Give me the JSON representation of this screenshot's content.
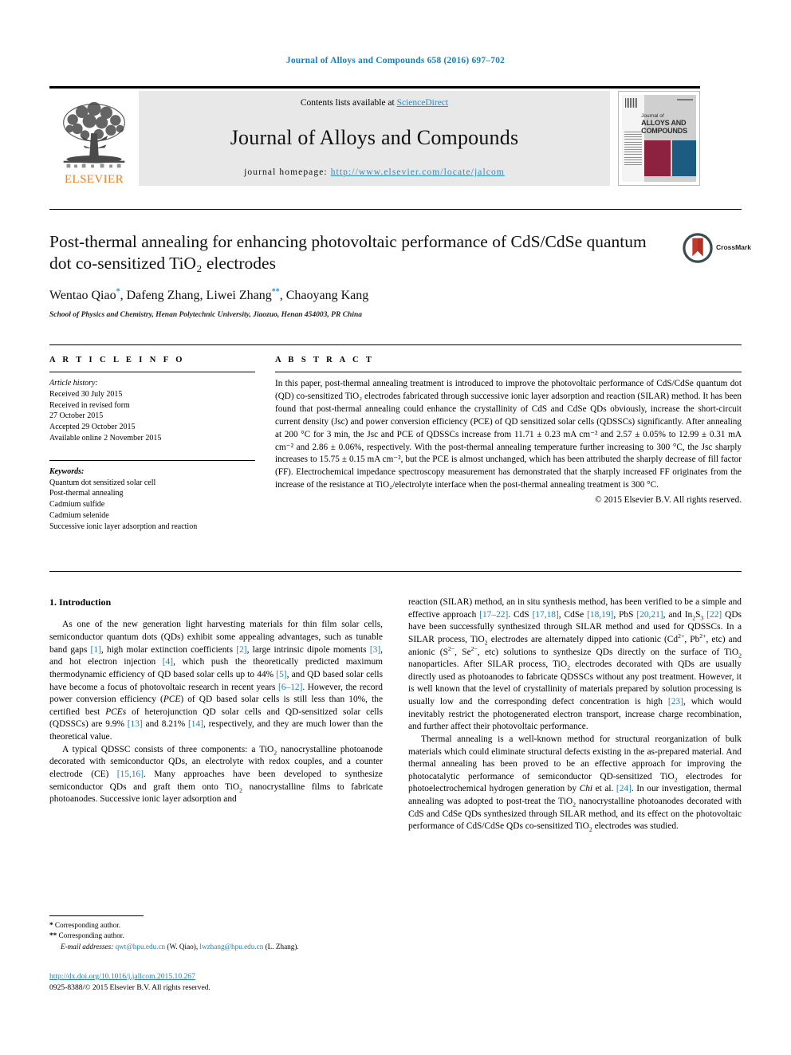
{
  "journal_ref": "Journal of Alloys and Compounds 658 (2016) 697–702",
  "masthead": {
    "contents_prefix": "Contents lists available at ",
    "sciencedirect": "ScienceDirect",
    "journal_title": "Journal of Alloys and Compounds",
    "homepage_prefix": "journal homepage: ",
    "homepage_url": "http://www.elsevier.com/locate/jalcom",
    "publisher": "ELSEVIER",
    "cover_title_small": "Journal of",
    "cover_title_main": "ALLOYS AND COMPOUNDS"
  },
  "article": {
    "title": "Post-thermal annealing for enhancing photovoltaic performance of CdS/CdSe quantum dot co-sensitized TiO₂ electrodes",
    "authors": "Wentao Qiao*, Dafeng Zhang, Liwei Zhang**, Chaoyang Kang",
    "affiliation": "School of Physics and Chemistry, Henan Polytechnic University, Jiaozuo, Henan 454003, PR China",
    "crossmark_label": "CrossMark"
  },
  "article_info": {
    "heading": "A R T I C L E  I N F O",
    "history_label": "Article history:",
    "history": [
      "Received 30 July 2015",
      "Received in revised form",
      "27 October 2015",
      "Accepted 29 October 2015",
      "Available online 2 November 2015"
    ],
    "keywords_label": "Keywords:",
    "keywords": [
      "Quantum dot sensitized solar cell",
      "Post-thermal annealing",
      "Cadmium sulfide",
      "Cadmium selenide",
      "Successive ionic layer adsorption and reaction"
    ]
  },
  "abstract": {
    "heading": "A B S T R A C T",
    "text": "In this paper, post-thermal annealing treatment is introduced to improve the photovoltaic performance of CdS/CdSe quantum dot (QD) co-sensitized TiO₂ electrodes fabricated through successive ionic layer adsorption and reaction (SILAR) method. It has been found that post-thermal annealing could enhance the crystallinity of CdS and CdSe QDs obviously, increase the short-circuit current density (Jsc) and power conversion efficiency (PCE) of QD sensitized solar cells (QDSSCs) significantly. After annealing at 200 °C for 3 min, the Jsc and PCE of QDSSCs increase from 11.71 ± 0.23 mA cm⁻² and 2.57 ± 0.05% to 12.99 ± 0.31 mA cm⁻² and 2.86 ± 0.06%, respectively. With the post-thermal annealing temperature further increasing to 300 °C, the Jsc sharply increases to 15.75 ± 0.15 mA cm⁻², but the PCE is almost unchanged, which has been attributed the sharply decrease of fill factor (FF). Electrochemical impedance spectroscopy measurement has demonstrated that the sharply increased FF originates from the increase of the resistance at TiO₂/electrolyte interface when the post-thermal annealing treatment is 300 °C.",
    "copyright": "© 2015 Elsevier B.V. All rights reserved."
  },
  "introduction": {
    "heading": "1. Introduction",
    "left_paragraphs": [
      "As one of the new generation light harvesting materials for thin film solar cells, semiconductor quantum dots (QDs) exhibit some appealing advantages, such as tunable band gaps [1], high molar extinction coefficients [2], large intrinsic dipole moments [3], and hot electron injection [4], which push the theoretically predicted maximum thermodynamic efficiency of QD based solar cells up to 44% [5], and QD based solar cells have become a focus of photovoltaic research in recent years [6–12]. However, the record power conversion efficiency (PCE) of QD based solar cells is still less than 10%, the certified best PCEs of heterojunction QD solar cells and QD-sensitized solar cells (QDSSCs) are 9.9% [13] and 8.21% [14], respectively, and they are much lower than the theoretical value.",
      "A typical QDSSC consists of three components: a TiO₂ nanocrystalline photoanode decorated with semiconductor QDs, an electrolyte with redox couples, and a counter electrode (CE) [15,16]. Many approaches have been developed to synthesize semiconductor QDs and graft them onto TiO₂ nanocrystalline films to fabricate photoanodes. Successive ionic layer adsorption and"
    ],
    "right_paragraphs": [
      "reaction (SILAR) method, an in situ synthesis method, has been verified to be a simple and effective approach [17–22]. CdS [17,18], CdSe [18,19], PbS [20,21], and In₂S₃ [22] QDs have been successfully synthesized through SILAR method and used for QDSSCs. In a SILAR process, TiO₂ electrodes are alternately dipped into cationic (Cd²⁺, Pb²⁺, etc) and anionic (S²⁻, Se²⁻, etc) solutions to synthesize QDs directly on the surface of TiO₂ nanoparticles. After SILAR process, TiO₂ electrodes decorated with QDs are usually directly used as photoanodes to fabricate QDSSCs without any post treatment. However, it is well known that the level of crystallinity of materials prepared by solution processing is usually low and the corresponding defect concentration is high [23], which would inevitably restrict the photogenerated electron transport, increase charge recombination, and further affect their photovoltaic performance.",
      "Thermal annealing is a well-known method for structural reorganization of bulk materials which could eliminate structural defects existing in the as-prepared material. And thermal annealing has been proved to be an effective approach for improving the photocatalytic performance of semiconductor QD-sensitized TiO₂ electrodes for photoelectrochemical hydrogen generation by Chi et al. [24]. In our investigation, thermal annealing was adopted to post-treat the TiO₂ nanocrystalline photoanodes decorated with CdS and CdSe QDs synthesized through SILAR method, and its effect on the photovoltaic performance of CdS/CdSe QDs co-sensitized TiO₂ electrodes was studied."
    ]
  },
  "footnotes": {
    "corresponding_1": "Corresponding author.",
    "corresponding_2": "Corresponding author.",
    "email_label": "E-mail addresses:",
    "email_1": "qwt@hpu.edu.cn",
    "email_1_name": "(W. Qiao),",
    "email_2": "lwzhang@hpu.edu.cn",
    "email_2_name": "(L. Zhang)."
  },
  "doi_block": {
    "doi": "http://dx.doi.org/10.1016/j.jallcom.2015.10.267",
    "issn": "0925-8388/© 2015 Elsevier B.V. All rights reserved."
  },
  "colors": {
    "link": "#1f7fb5",
    "elsevier_orange": "#ef7d1a",
    "cover_maroon": "#8c2140",
    "cover_blue": "#1d5c82"
  }
}
